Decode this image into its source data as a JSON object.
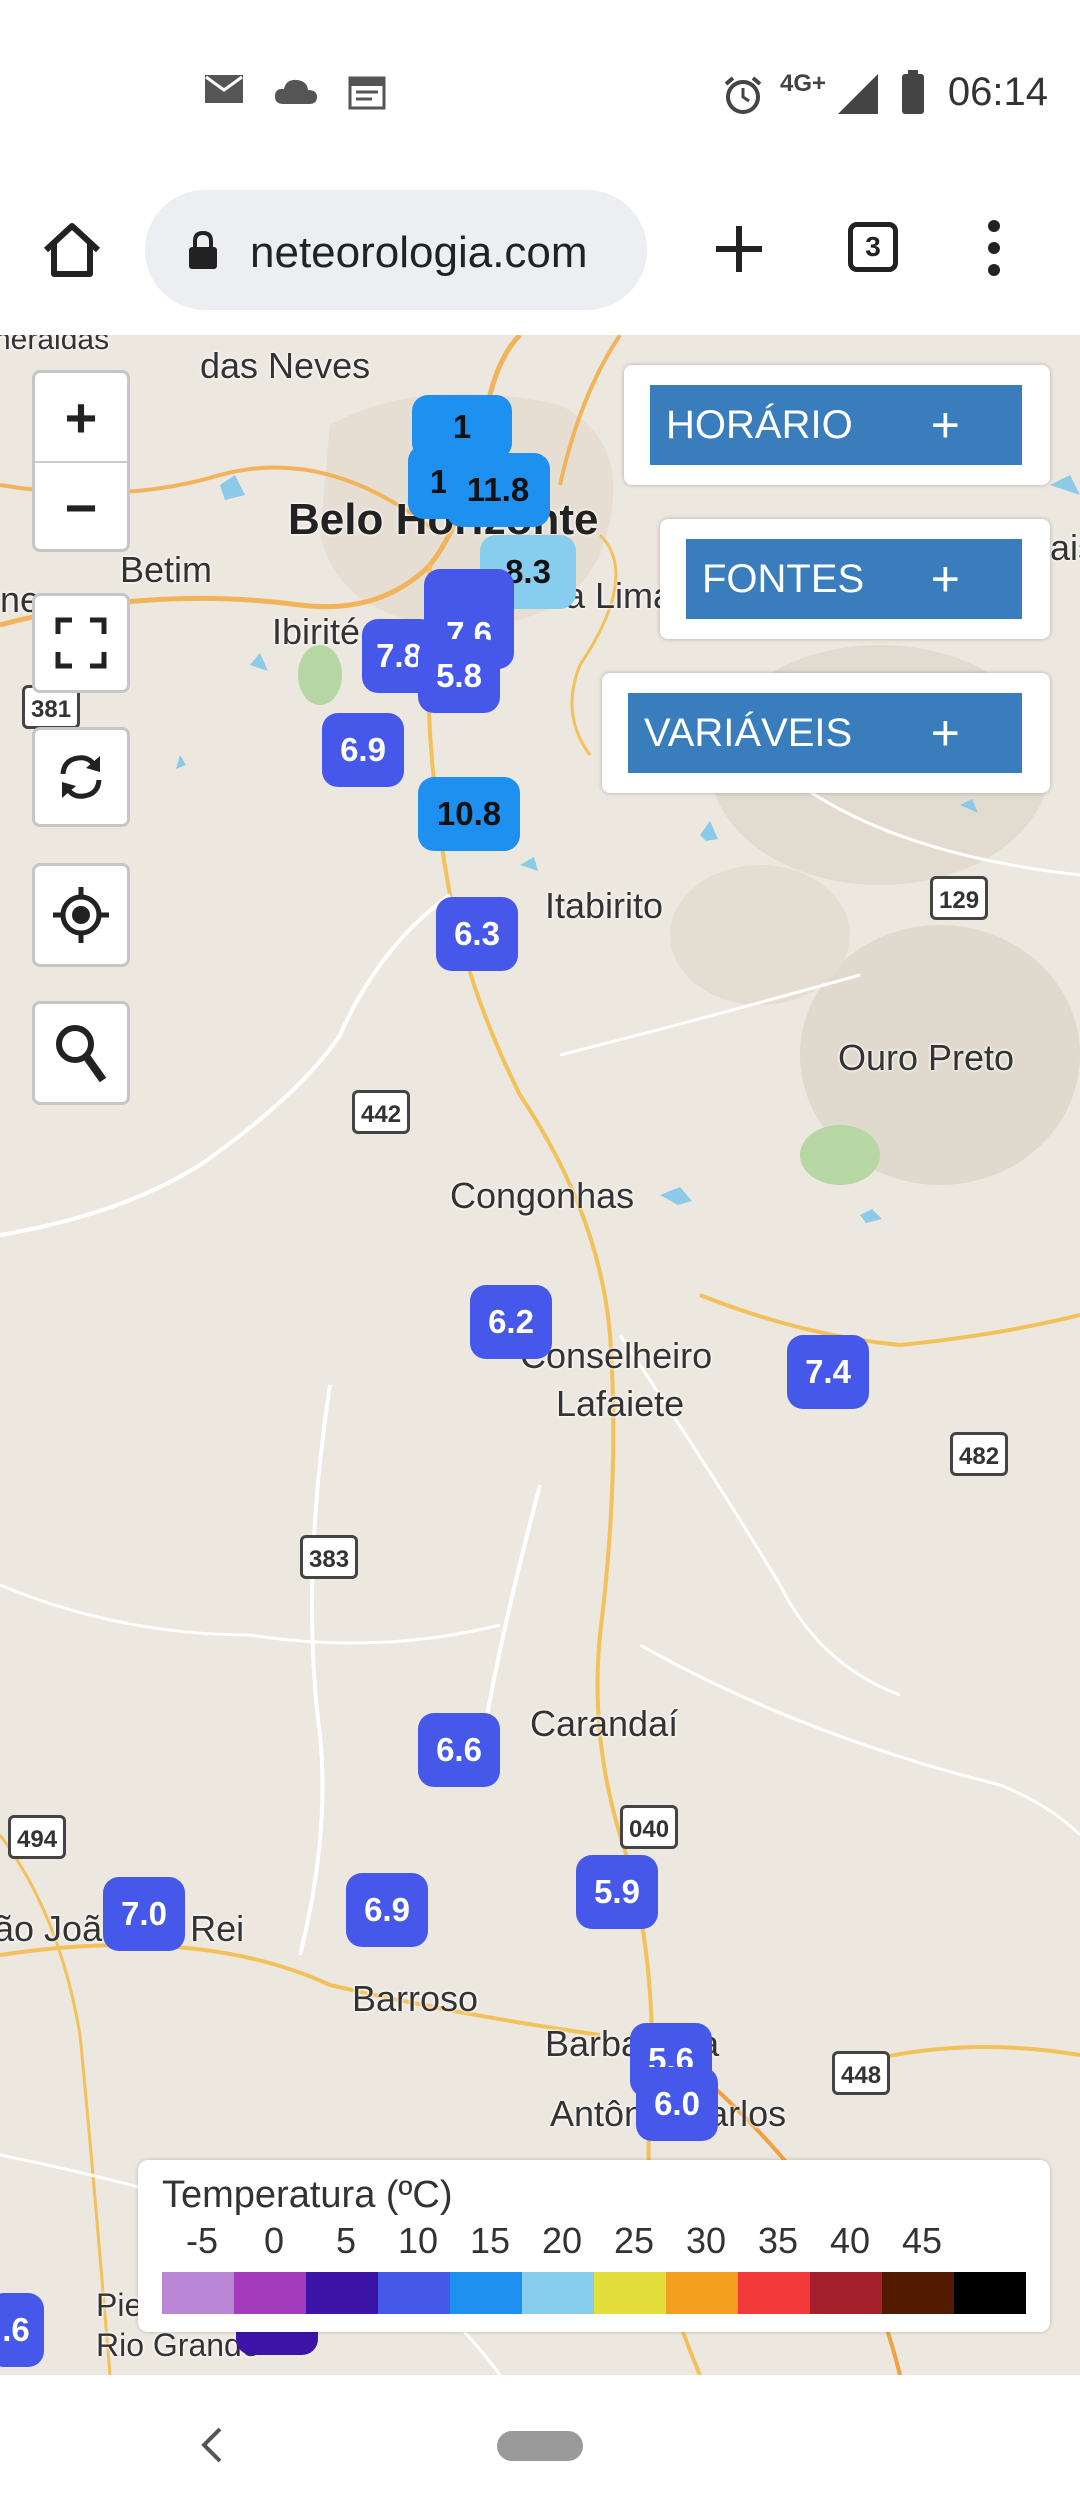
{
  "status_bar": {
    "time": "06:14",
    "network": "4G+",
    "icons": [
      "mail-icon",
      "cloud-icon",
      "calendar-icon",
      "alarm-icon",
      "signal-icon",
      "battery-icon"
    ]
  },
  "browser": {
    "url": "neteorologia.com",
    "tab_count": "3"
  },
  "map": {
    "controls": {
      "zoom_in": "+",
      "zoom_out": "−"
    },
    "panels": [
      {
        "label": "HORÁRIO",
        "plus": "+"
      },
      {
        "label": "FONTES",
        "plus": "+"
      },
      {
        "label": "VARIÁVEIS",
        "plus": "+"
      }
    ],
    "places": {
      "neraldas": "neraldas",
      "das_neves": "das Neves",
      "belo_horizonte": "Belo Horizonte",
      "betim": "Betim",
      "ibirite": "Ibirité",
      "nova_lima": "a Lima",
      "ne": "ne",
      "ais": "ais",
      "itabirito": "Itabirito",
      "ouro_preto": "Ouro Preto",
      "congonhas": "Congonhas",
      "conselheiro": "Conselheiro",
      "lafaiete": "Lafaiete",
      "carandai": "Carandaí",
      "sao_joao": "ão João del Rei",
      "barroso": "Barroso",
      "barbacena": "Barbacena",
      "antonio_carlos": "Antônio Carlos",
      "pie": "Pie",
      "rio_grande": "Rio Grande"
    },
    "road_shields": {
      "r381": "381",
      "r129": "129",
      "r442": "442",
      "r482": "482",
      "r383": "383",
      "r494": "494",
      "r040": "040",
      "r448": "448"
    },
    "markers": {
      "bh1": "11.8",
      "bh1b": "1",
      "bh_top": "1",
      "bh2": "8.3",
      "bh3": "7.6",
      "bh4": "7.8",
      "bh5": "5.8",
      "ibirite": "6.9",
      "south_bh": "10.8",
      "itabirito": "6.3",
      "congonhas": "6.2",
      "east": "7.4",
      "carandai": "6.6",
      "sjdr": "7.0",
      "barroso": "6.9",
      "r040": "5.9",
      "barbacena1": "5.6",
      "barbacena2": "6.0",
      "edge": ".6"
    },
    "legend": {
      "title": "Temperatura (ºC)",
      "ticks": [
        "-5",
        "0",
        "5",
        "10",
        "15",
        "20",
        "25",
        "30",
        "35",
        "40",
        "45"
      ],
      "colors": [
        "#b987d6",
        "#a53cbd",
        "#3c14a8",
        "#4658e9",
        "#1e90f0",
        "#86cdee",
        "#e3de3b",
        "#f3a020",
        "#f23a3a",
        "#a3202c",
        "#521b00",
        "#000000"
      ]
    }
  }
}
